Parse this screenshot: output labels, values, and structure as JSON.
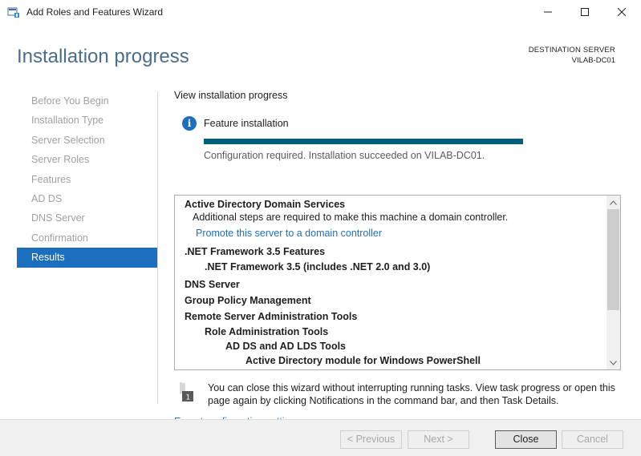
{
  "window": {
    "title": "Add Roles and Features Wizard",
    "minimize_label": "",
    "maximize_label": "",
    "close_label": ""
  },
  "header": {
    "page_title": "Installation progress",
    "destination_label": "DESTINATION SERVER",
    "destination_server": "VILAB-DC01"
  },
  "sidebar": {
    "items": [
      {
        "label": "Before You Begin"
      },
      {
        "label": "Installation Type"
      },
      {
        "label": "Server Selection"
      },
      {
        "label": "Server Roles"
      },
      {
        "label": "Features"
      },
      {
        "label": "AD DS"
      },
      {
        "label": "DNS Server"
      },
      {
        "label": "Confirmation"
      },
      {
        "label": "Results"
      }
    ],
    "active_index": 8
  },
  "main": {
    "view_progress_label": "View installation progress",
    "feature_label": "Feature installation",
    "progress_percent": 100,
    "status_text": "Configuration required. Installation succeeded on VILAB-DC01.",
    "results": [
      {
        "text": "Active Directory Domain Services",
        "style": "head",
        "indent": 0
      },
      {
        "text": "Additional steps are required to make this machine a domain controller.",
        "style": "text",
        "indent": 1
      },
      {
        "text": "Promote this server to a domain controller",
        "style": "link",
        "indent": 1
      },
      {
        "text": ".NET Framework 3.5 Features",
        "style": "head",
        "indent": 0
      },
      {
        "text": ".NET Framework 3.5 (includes .NET 2.0 and 3.0)",
        "style": "head",
        "indent": 2
      },
      {
        "text": "DNS Server",
        "style": "head",
        "indent": 0
      },
      {
        "text": "Group Policy Management",
        "style": "head",
        "indent": 0
      },
      {
        "text": "Remote Server Administration Tools",
        "style": "head",
        "indent": 0
      },
      {
        "text": "Role Administration Tools",
        "style": "head",
        "indent": 2
      },
      {
        "text": "AD DS and AD LDS Tools",
        "style": "head",
        "indent": 3
      },
      {
        "text": "Active Directory module for Windows PowerShell",
        "style": "head",
        "indent": 4
      }
    ],
    "notice_text": "You can close this wizard without interrupting running tasks. View task progress or open this page again by clicking Notifications in the command bar, and then Task Details.",
    "export_link": "Export configuration settings"
  },
  "footer": {
    "previous_label": "< Previous",
    "next_label": "Next >",
    "close_label": "Close",
    "cancel_label": "Cancel"
  },
  "colors": {
    "accent": "#1c6fbf",
    "title": "#4a6d8c",
    "progress": "#00607a"
  },
  "icons": {
    "app": "server-manager-icon",
    "info": "info-icon",
    "notice": "flag-notification-icon"
  }
}
